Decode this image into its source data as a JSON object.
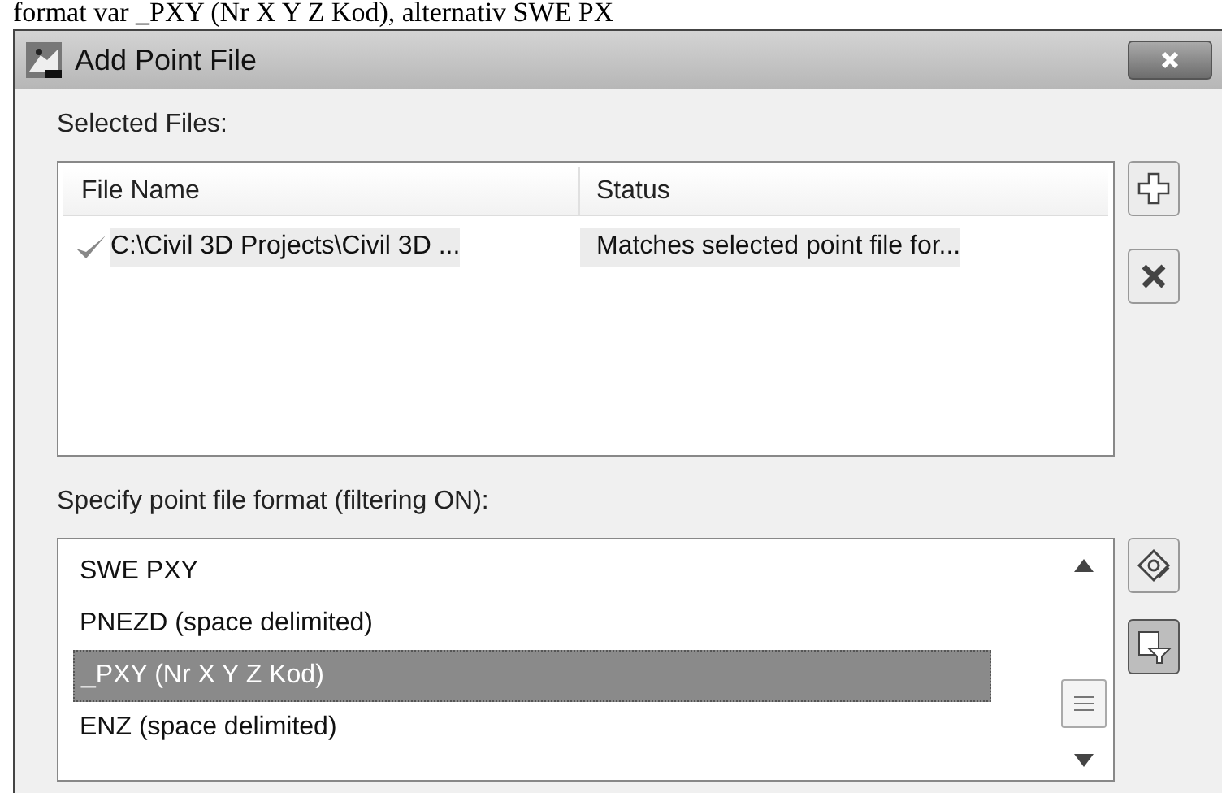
{
  "document_text": "format var _PXY (Nr X Y Z Kod), alternativ SWE PX",
  "window": {
    "title": "Add Point File"
  },
  "selected_files": {
    "label": "Selected Files:",
    "columns": [
      "File Name",
      "Status"
    ],
    "rows": [
      {
        "file_name": "C:\\Civil 3D Projects\\Civil 3D ...",
        "status": "Matches selected point file for...",
        "valid": true
      }
    ]
  },
  "format_list": {
    "label": "Specify point file format (filtering ON):",
    "items": [
      {
        "label": "SWE PXY",
        "selected": false
      },
      {
        "label": "PNEZD (space delimited)",
        "selected": false
      },
      {
        "label": "_PXY (Nr X Y Z Kod)",
        "selected": true
      },
      {
        "label": "ENZ (space delimited)",
        "selected": false
      }
    ]
  },
  "filter_button": {
    "on": true
  }
}
